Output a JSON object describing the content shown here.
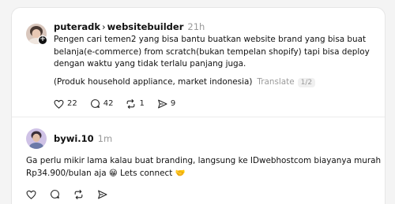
{
  "posts": [
    {
      "username": "puteradk",
      "separator": "›",
      "community": "websitebuilder",
      "time": "21h",
      "text_lines": [
        "Pengen cari temen2 yang bisa bantu buatkan website brand yang bisa buat",
        "belanja(e-commerce) from scratch(bukan tempelan shopify) tapi bisa deploy",
        "dengan waktu yang tidak terlalu panjang juga."
      ],
      "note": "(Produk household appliance, market indonesia)",
      "translate_label": "Translate",
      "pager": "1/2",
      "likes": "22",
      "replies": "42",
      "reposts": "1",
      "shares": "9"
    },
    {
      "username": "bywi.10",
      "time": "1m",
      "text_lines": [
        "Ga perlu mikir lama kalau buat branding, langsung ke IDwebhostcom biayanya murah",
        "Rp34.900/bulan aja 😁 Lets connect 🤝"
      ]
    }
  ],
  "icons": [
    "heart-icon",
    "comment-icon",
    "repost-icon",
    "share-icon",
    "follow-plus-icon"
  ]
}
